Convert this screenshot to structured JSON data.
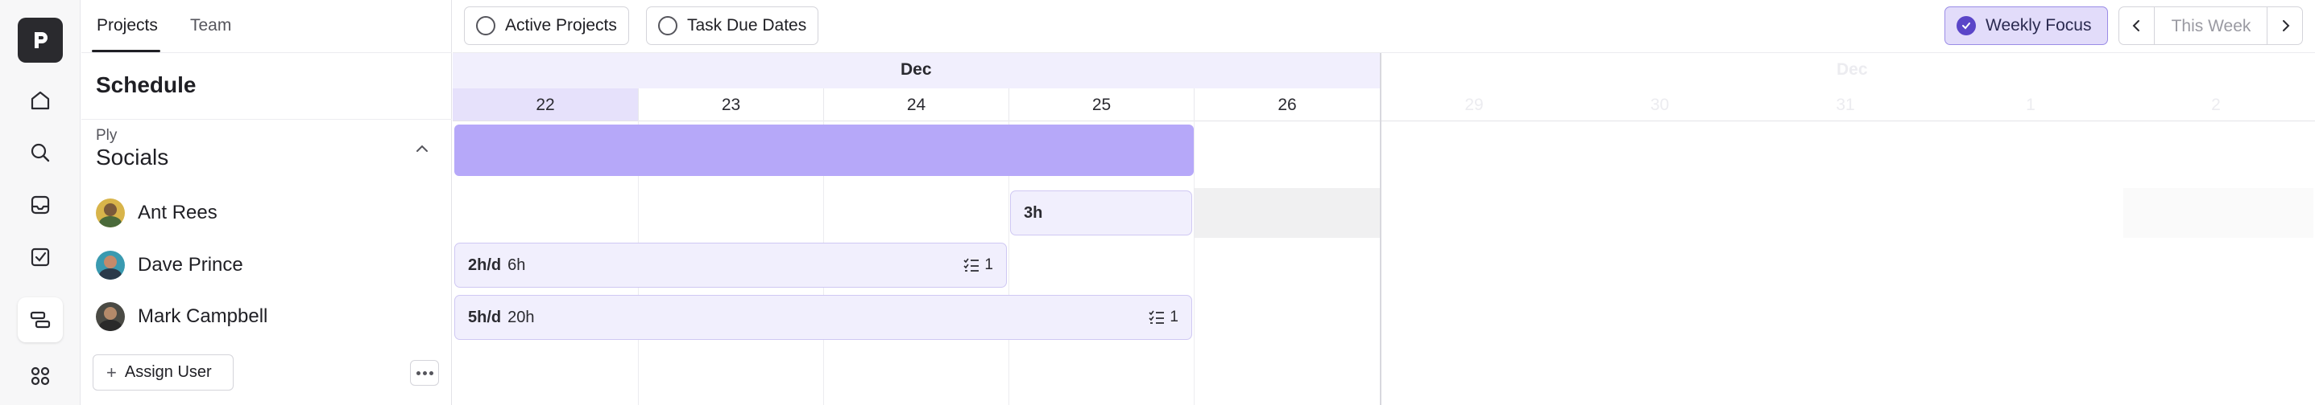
{
  "panel": {
    "tabs": [
      {
        "label": "Projects"
      },
      {
        "label": "Team"
      }
    ],
    "title": "Schedule",
    "client": "Ply",
    "project": "Socials",
    "users": [
      {
        "name": "Ant Rees"
      },
      {
        "name": "Dave Prince"
      },
      {
        "name": "Mark Campbell"
      }
    ],
    "assign_label": "Assign User"
  },
  "toolbar": {
    "filters": [
      {
        "label": "Active Projects"
      },
      {
        "label": "Task Due Dates"
      }
    ],
    "weekly_focus": "Weekly Focus",
    "week_label": "This Week"
  },
  "calendar": {
    "month": "Dec",
    "days": [
      "22",
      "23",
      "24",
      "25",
      "26"
    ],
    "next_month": "Dec",
    "next_days": [
      "29",
      "30",
      "31",
      "1",
      "2"
    ],
    "allocations": [
      {
        "rate": "",
        "total": "3h",
        "tasks": ""
      },
      {
        "rate": "2h/d",
        "total": "6h",
        "tasks": "1"
      },
      {
        "rate": "5h/d",
        "total": "20h",
        "tasks": "1"
      }
    ]
  },
  "colors": {
    "accent": "#5a45c8",
    "project_bar": "#b6a8f9",
    "allocation_bg": "#f1effd"
  },
  "icons": [
    "logo-icon",
    "home-icon",
    "search-icon",
    "inbox-icon",
    "tasks-icon",
    "schedule-icon",
    "apps-icon",
    "chevron-up-icon",
    "plus-icon",
    "more-icon",
    "check-icon",
    "chevron-left-icon",
    "chevron-right-icon",
    "task-list-icon"
  ]
}
